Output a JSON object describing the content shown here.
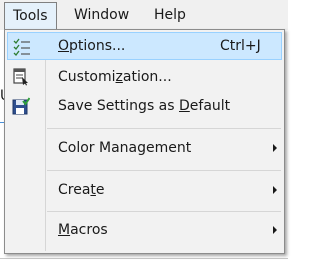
{
  "menubar": {
    "items": [
      "Tools",
      "Window",
      "Help"
    ]
  },
  "background": {
    "left_fragment": "U"
  },
  "menu": {
    "items": [
      {
        "label_underlined": "O",
        "label_rest": "ptions...",
        "shortcut": "Ctrl+J",
        "icon": "options-list-icon"
      },
      {
        "label_pre": "Customi",
        "label_underlined": "z",
        "label_rest": "ation...",
        "icon": "customize-window-icon"
      },
      {
        "label_pre": "Save Settings as ",
        "label_underlined": "D",
        "label_rest": "efault",
        "icon": "save-settings-icon"
      },
      {
        "label": "Color Management"
      },
      {
        "label_pre": "Crea",
        "label_underlined": "t",
        "label_rest": "e"
      },
      {
        "label_underlined": "M",
        "label_rest": "acros"
      }
    ]
  },
  "colors": {
    "hover_bg": "#cce8ff",
    "hover_border": "#99d1ff",
    "menu_bg": "#f2f2f2"
  }
}
